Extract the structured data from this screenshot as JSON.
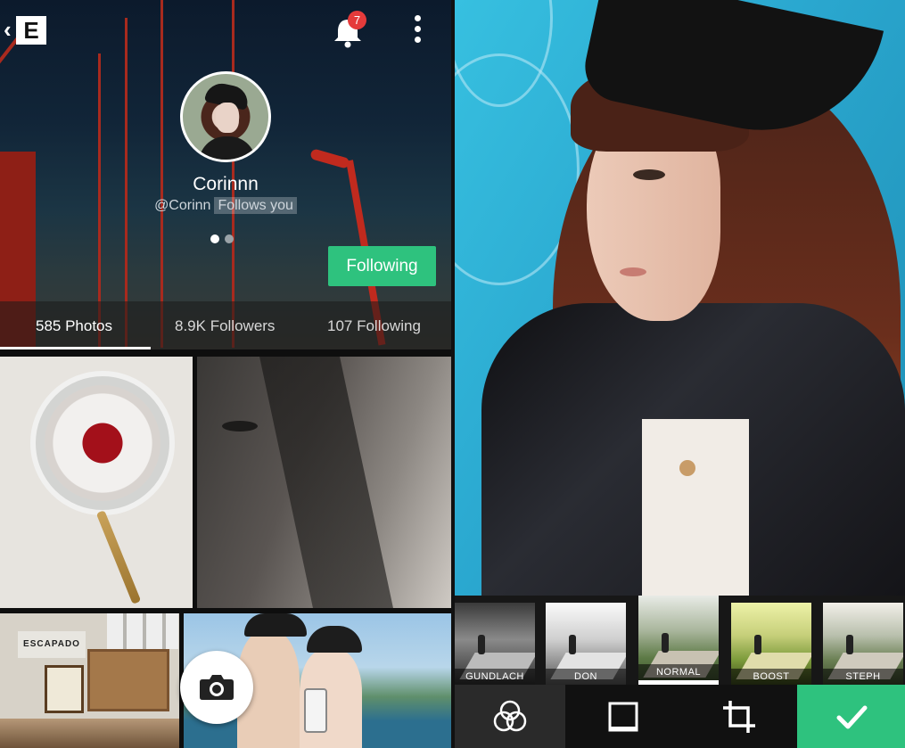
{
  "profile": {
    "name": "Corinnn",
    "handle": "@Corinn",
    "follows_you": "Follows you",
    "notification_count": "7",
    "follow_button": "Following",
    "stats": [
      {
        "label": "585 Photos",
        "active": true
      },
      {
        "label": "8.9K Followers",
        "active": false
      },
      {
        "label": "107 Following",
        "active": false
      }
    ],
    "board_sign": "ESCAPADO",
    "accent_color": "#2ec27e"
  },
  "editor": {
    "filters": [
      {
        "label": "GUNDLACH",
        "selected": false
      },
      {
        "label": "DON",
        "selected": false
      },
      {
        "label": "NORMAL",
        "selected": true
      },
      {
        "label": "BOOST",
        "selected": false
      },
      {
        "label": "STEPH",
        "selected": false
      }
    ],
    "tools": [
      "filters-icon",
      "frame-icon",
      "crop-icon",
      "checkmark-icon"
    ]
  }
}
